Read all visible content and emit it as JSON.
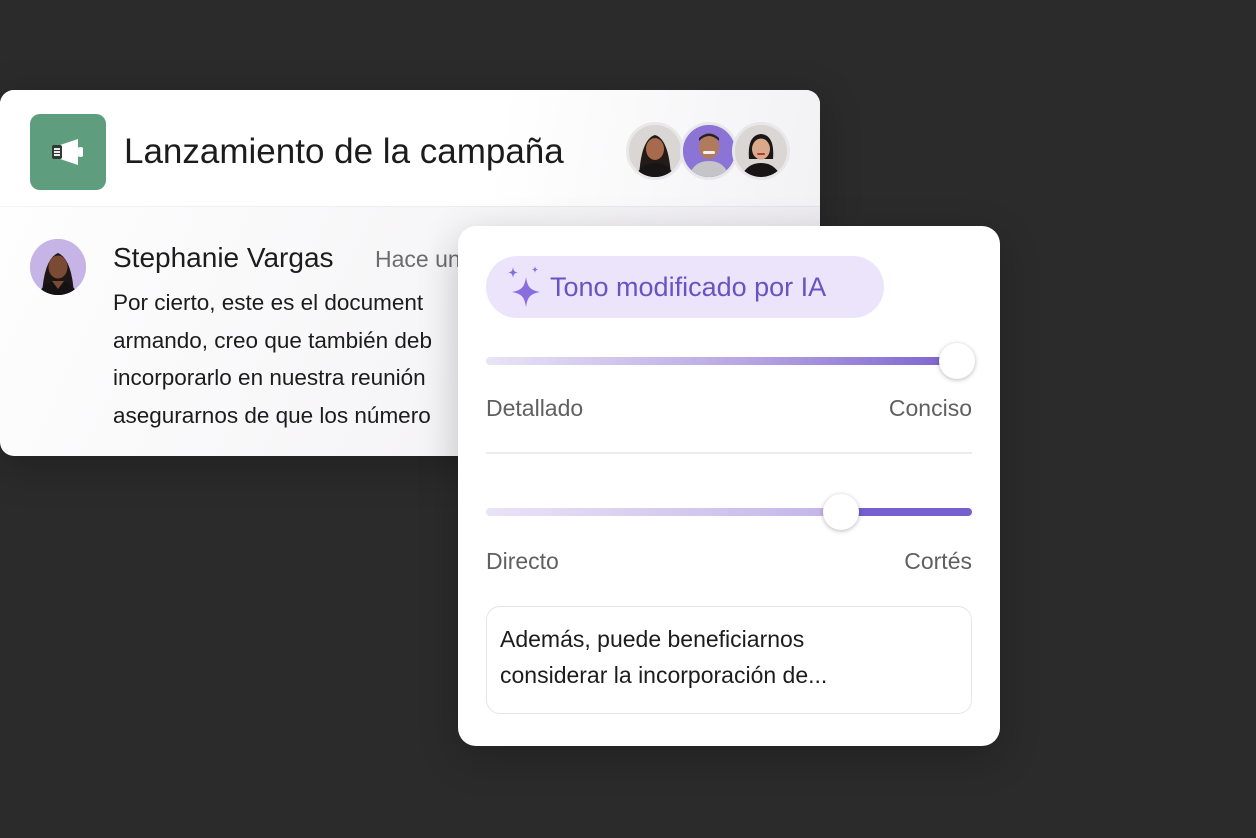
{
  "chat": {
    "channel_title": "Lanzamiento de la campaña",
    "channel_icon": "megaphone-icon",
    "channel_icon_color": "#5e9d7d",
    "members": [
      {
        "name": "member-1",
        "bg": "#d9d6d3"
      },
      {
        "name": "member-2",
        "bg": "#8b74d6"
      },
      {
        "name": "member-3",
        "bg": "#d9d6d3"
      }
    ],
    "message": {
      "author": "Stephanie Vargas",
      "time": "Hace un",
      "lines": [
        "Por cierto, este es el document",
        "armando, creo que también deb",
        "incorporarlo en nuestra reunión",
        "asegurarnos de que los número"
      ]
    }
  },
  "tone": {
    "badge_label": "Tono modificado por IA",
    "badge_icon": "sparkles-icon",
    "accent_color": "#6b52c2",
    "sliders": [
      {
        "left_label": "Detallado",
        "right_label": "Conciso",
        "value": 0.97
      },
      {
        "left_label": "Directo",
        "right_label": "Cortés",
        "value": 0.73
      }
    ],
    "preview_lines": [
      "Además, puede beneficiarnos",
      "considerar la incorporación de..."
    ]
  }
}
